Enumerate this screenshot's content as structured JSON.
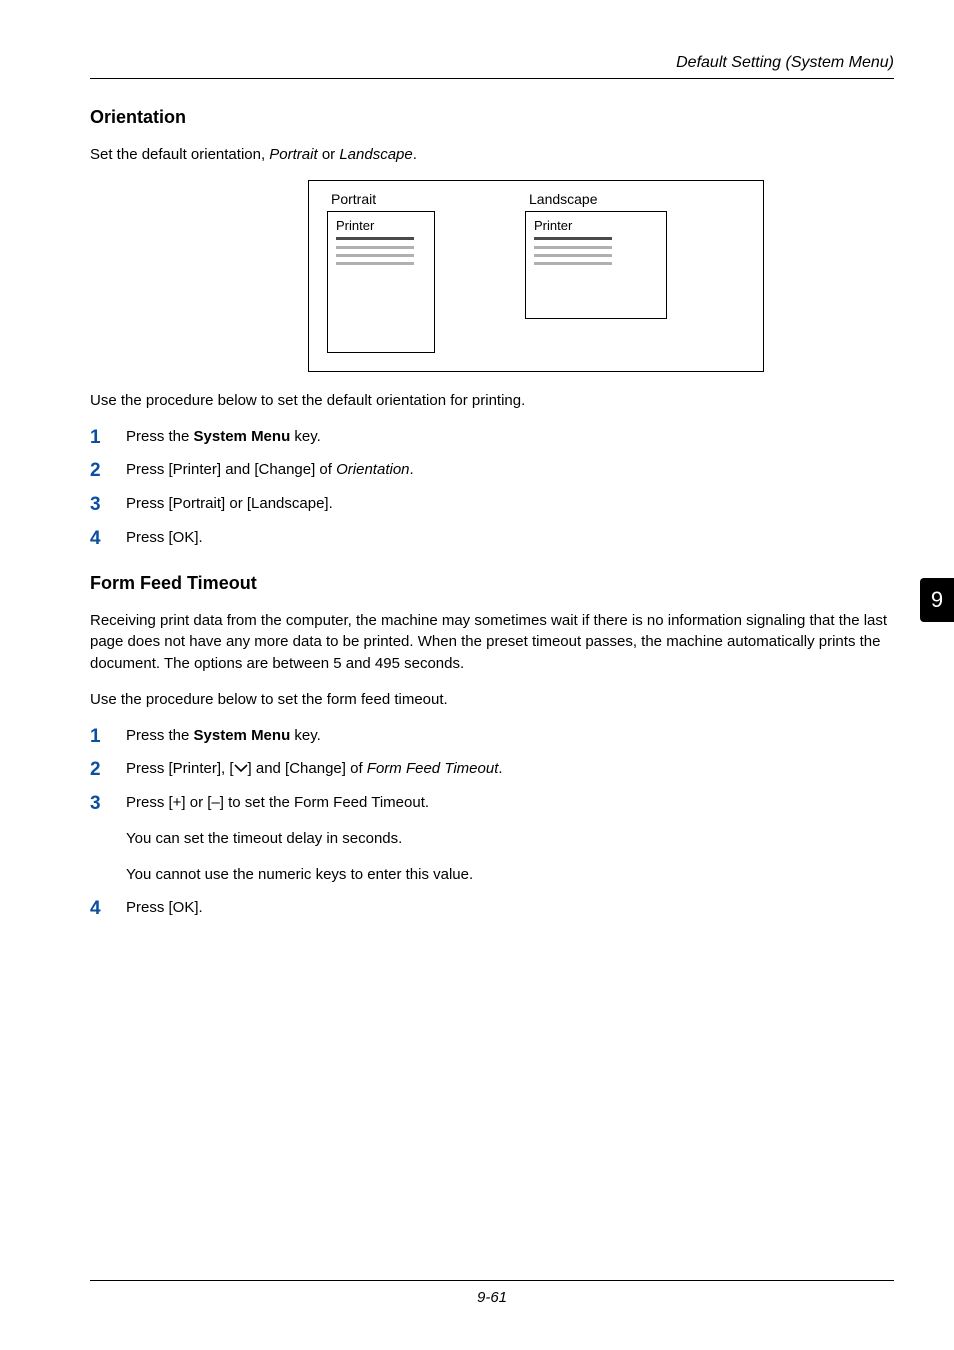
{
  "header": {
    "text": "Default Setting (System Menu)"
  },
  "chapter_tab": "9",
  "section1": {
    "title": "Orientation",
    "intro_pre": "Set the default orientation, ",
    "intro_em1": "Portrait",
    "intro_mid": " or ",
    "intro_em2": "Landscape",
    "intro_post": ".",
    "diagram": {
      "portrait_label": "Portrait",
      "landscape_label": "Landscape",
      "page_title": "Printer"
    },
    "lead": "Use the procedure below to set the default orientation for printing.",
    "steps": {
      "s1_pre": "Press the ",
      "s1_b": "System Menu",
      "s1_post": " key.",
      "s2_pre": "Press [Printer] and [Change] of ",
      "s2_em": "Orientation",
      "s2_post": ".",
      "s3": "Press [Portrait] or [Landscape].",
      "s4": "Press [OK]."
    }
  },
  "section2": {
    "title": "Form Feed Timeout",
    "para": "Receiving print data from the computer, the machine may sometimes wait if there is no information signaling that the last page does not have any more data to be printed. When the preset timeout passes, the machine automatically prints the document. The options are between 5 and 495 seconds.",
    "lead": "Use the procedure below to set the form feed timeout.",
    "steps": {
      "s1_pre": "Press the ",
      "s1_b": "System Menu",
      "s1_post": " key.",
      "s2_pre": "Press [Printer], [",
      "s2_post_icon": "] and [Change] of ",
      "s2_em": "Form Feed Timeout",
      "s2_post": ".",
      "s3": "Press [+] or [–] to set the Form Feed Timeout.",
      "s3_sub1": "You can set the timeout delay in seconds.",
      "s3_sub2": "You cannot use the numeric keys to enter this value.",
      "s4": "Press [OK]."
    }
  },
  "footer": {
    "page_number": "9-61"
  }
}
